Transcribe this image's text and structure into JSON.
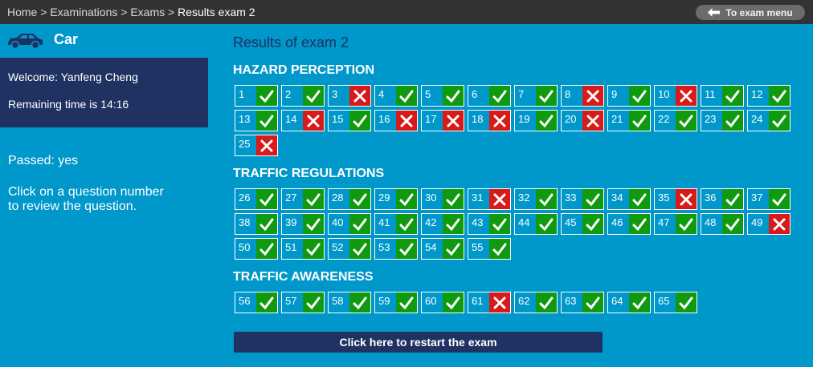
{
  "breadcrumb": {
    "items": [
      "Home",
      "Examinations",
      "Exams"
    ],
    "separator": ">",
    "current": "Results exam 2"
  },
  "exam_menu_label": "To exam menu",
  "sidebar": {
    "title": "Car",
    "welcome": "Welcome: Yanfeng Cheng",
    "remaining_time": "Remaining time is 14:16",
    "passed": "Passed: yes",
    "hint_line1": "Click on a question number",
    "hint_line2": "to review the question."
  },
  "results_title": "Results of exam 2",
  "sections": [
    {
      "title": "HAZARD PERCEPTION",
      "questions": [
        {
          "n": "1",
          "r": "correct"
        },
        {
          "n": "2",
          "r": "correct"
        },
        {
          "n": "3",
          "r": "incorrect"
        },
        {
          "n": "4",
          "r": "correct"
        },
        {
          "n": "5",
          "r": "correct"
        },
        {
          "n": "6",
          "r": "correct"
        },
        {
          "n": "7",
          "r": "correct"
        },
        {
          "n": "8",
          "r": "incorrect"
        },
        {
          "n": "9",
          "r": "correct"
        },
        {
          "n": "10",
          "r": "incorrect"
        },
        {
          "n": "11",
          "r": "correct"
        },
        {
          "n": "12",
          "r": "correct"
        },
        {
          "n": "13",
          "r": "correct"
        },
        {
          "n": "14",
          "r": "incorrect"
        },
        {
          "n": "15",
          "r": "correct"
        },
        {
          "n": "16",
          "r": "incorrect"
        },
        {
          "n": "17",
          "r": "incorrect"
        },
        {
          "n": "18",
          "r": "incorrect"
        },
        {
          "n": "19",
          "r": "correct"
        },
        {
          "n": "20",
          "r": "incorrect"
        },
        {
          "n": "21",
          "r": "correct"
        },
        {
          "n": "22",
          "r": "correct"
        },
        {
          "n": "23",
          "r": "correct"
        },
        {
          "n": "24",
          "r": "correct"
        },
        {
          "n": "25",
          "r": "incorrect"
        }
      ]
    },
    {
      "title": "TRAFFIC REGULATIONS",
      "questions": [
        {
          "n": "26",
          "r": "correct"
        },
        {
          "n": "27",
          "r": "correct"
        },
        {
          "n": "28",
          "r": "correct"
        },
        {
          "n": "29",
          "r": "correct"
        },
        {
          "n": "30",
          "r": "correct"
        },
        {
          "n": "31",
          "r": "incorrect"
        },
        {
          "n": "32",
          "r": "correct"
        },
        {
          "n": "33",
          "r": "correct"
        },
        {
          "n": "34",
          "r": "correct"
        },
        {
          "n": "35",
          "r": "incorrect"
        },
        {
          "n": "36",
          "r": "correct"
        },
        {
          "n": "37",
          "r": "correct"
        },
        {
          "n": "38",
          "r": "correct"
        },
        {
          "n": "39",
          "r": "correct"
        },
        {
          "n": "40",
          "r": "correct"
        },
        {
          "n": "41",
          "r": "correct"
        },
        {
          "n": "42",
          "r": "correct"
        },
        {
          "n": "43",
          "r": "correct"
        },
        {
          "n": "44",
          "r": "correct"
        },
        {
          "n": "45",
          "r": "correct"
        },
        {
          "n": "46",
          "r": "correct"
        },
        {
          "n": "47",
          "r": "correct"
        },
        {
          "n": "48",
          "r": "correct"
        },
        {
          "n": "49",
          "r": "incorrect"
        },
        {
          "n": "50",
          "r": "correct"
        },
        {
          "n": "51",
          "r": "correct"
        },
        {
          "n": "52",
          "r": "correct"
        },
        {
          "n": "53",
          "r": "correct"
        },
        {
          "n": "54",
          "r": "correct"
        },
        {
          "n": "55",
          "r": "correct"
        }
      ]
    },
    {
      "title": "TRAFFIC AWARENESS",
      "questions": [
        {
          "n": "56",
          "r": "correct"
        },
        {
          "n": "57",
          "r": "correct"
        },
        {
          "n": "58",
          "r": "correct"
        },
        {
          "n": "59",
          "r": "correct"
        },
        {
          "n": "60",
          "r": "correct"
        },
        {
          "n": "61",
          "r": "incorrect"
        },
        {
          "n": "62",
          "r": "correct"
        },
        {
          "n": "63",
          "r": "correct"
        },
        {
          "n": "64",
          "r": "correct"
        },
        {
          "n": "65",
          "r": "correct"
        }
      ]
    }
  ],
  "restart_label": "Click here to restart the exam",
  "icons": {
    "correct": "checkmark-icon",
    "incorrect": "cross-icon",
    "back": "arrow-left-icon",
    "vehicle": "car-icon"
  },
  "colors": {
    "background": "#0097ca",
    "topbar": "#333333",
    "panel": "#1f3262",
    "correct": "#109a10",
    "incorrect": "#d81a1a"
  }
}
